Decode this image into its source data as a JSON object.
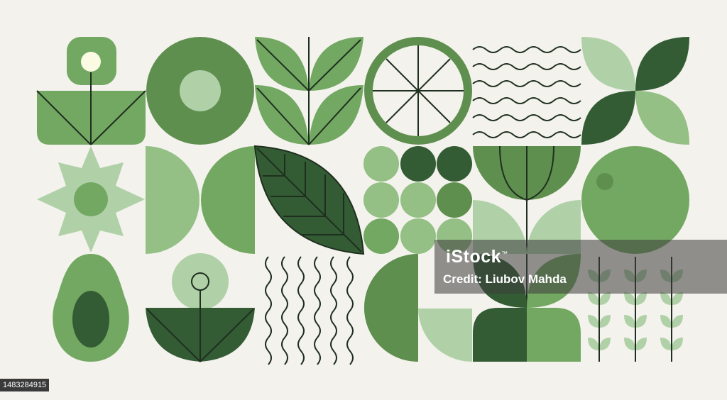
{
  "colors": {
    "background": "#f3f2ec",
    "light": "#b0d1a8",
    "medium_light": "#94bf85",
    "medium": "#73a862",
    "medium_dark": "#5f8f4e",
    "dark": "#335c34",
    "cream": "#fbfbe4",
    "line": "#1f2f1f"
  },
  "icons": [
    "flower-icon",
    "orange-slice-icon",
    "sprout-icon",
    "lemon-slice-icon",
    "wave-lines-icon",
    "four-petal-icon",
    "daisy-icon",
    "half-circles-icon",
    "leaf-icon",
    "berry-grid-icon",
    "tulip-icon",
    "apple-icon",
    "avocado-icon",
    "small-flower-icon",
    "vertical-waves-icon",
    "wheat-icon"
  ],
  "watermark": {
    "logo": "iStock",
    "logo_mark": "™",
    "credit": "Credit: Liubov Mahda"
  },
  "stock_id": "1483284915"
}
